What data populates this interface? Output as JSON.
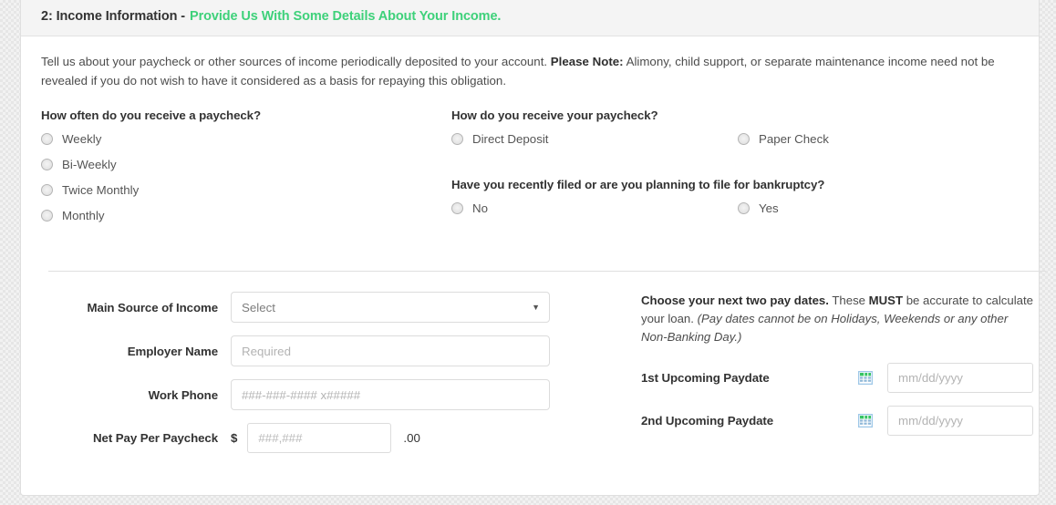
{
  "header": {
    "step_title": "2: Income Information -",
    "step_subtitle": "Provide Us With Some Details About Your Income.",
    "accent_color": "#3ed17a",
    "title_color": "#333333",
    "background": "#f4f4f4"
  },
  "intro": {
    "part1": "Tell us about your paycheck or other sources of income periodically deposited to your account. ",
    "note_label": "Please Note:",
    "part2": " Alimony, child support, or separate maintenance income need not be revealed if you do not wish to have it considered as a basis for repaying this obligation."
  },
  "questions": {
    "frequency": {
      "title": "How often do you receive a paycheck?",
      "options": [
        {
          "label": "Weekly",
          "selected": false
        },
        {
          "label": "Bi-Weekly",
          "selected": false
        },
        {
          "label": "Twice Monthly",
          "selected": false
        },
        {
          "label": "Monthly",
          "selected": false
        }
      ]
    },
    "method": {
      "title": "How do you receive your paycheck?",
      "options": [
        {
          "label": "Direct Deposit",
          "selected": false
        },
        {
          "label": "Paper Check",
          "selected": false
        }
      ]
    },
    "bankruptcy": {
      "title": "Have you recently filed or are you planning to file for bankruptcy?",
      "options": [
        {
          "label": "No",
          "selected": false
        },
        {
          "label": "Yes",
          "selected": false
        }
      ]
    }
  },
  "form": {
    "main_source": {
      "label": "Main Source of Income",
      "value": "Select",
      "caret_icon": "chevron-down-icon"
    },
    "employer_name": {
      "label": "Employer Name",
      "value": "",
      "placeholder": "Required"
    },
    "work_phone": {
      "label": "Work Phone",
      "value": "",
      "placeholder": "###-###-#### x#####"
    },
    "net_pay": {
      "label": "Net Pay Per Paycheck",
      "currency_symbol": "$",
      "value": "",
      "placeholder": "###,###",
      "cents_suffix": ".00"
    }
  },
  "paydates": {
    "note_bold": "Choose your next two pay dates.",
    "note_mid1": " These ",
    "note_must": "MUST",
    "note_mid2": " be accurate to calculate your loan. ",
    "note_italic": "(Pay dates cannot be on Holidays, Weekends or any other Non-Banking Day.)",
    "rows": [
      {
        "label": "1st Upcoming Paydate",
        "calendar_icon": "calendar-icon",
        "value": "",
        "placeholder": "mm/dd/yyyy"
      },
      {
        "label": "2nd Upcoming Paydate",
        "calendar_icon": "calendar-icon",
        "value": "",
        "placeholder": "mm/dd/yyyy"
      }
    ]
  }
}
